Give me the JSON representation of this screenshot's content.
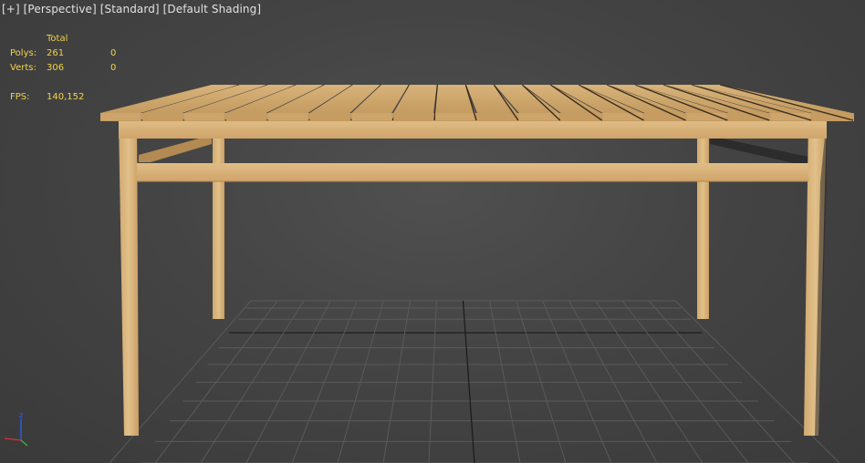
{
  "viewport": {
    "label_plus": "[+]",
    "label_view": "[Perspective]",
    "label_mode": "[Standard]",
    "label_shading": "[Default Shading]"
  },
  "stats": {
    "header_total": "Total",
    "polys_label": "Polys:",
    "polys_total": "261",
    "polys_selected": "0",
    "verts_label": "Verts:",
    "verts_total": "306",
    "verts_selected": "0",
    "fps_label": "FPS:",
    "fps_value": "140,152"
  },
  "gizmo": {
    "z_label": "z",
    "x_color": "#e03030",
    "y_color": "#30c030",
    "z_color": "#3060ff"
  },
  "colors": {
    "text_stats": "#f2d34a",
    "grid_line": "#5a5a5a",
    "grid_axis": "#1a1a1a",
    "wood_light": "#d9b37c",
    "wood_mid": "#c99f66",
    "wood_dark": "#9c7540"
  },
  "model": {
    "name": "wooden table",
    "slat_count": 18
  }
}
